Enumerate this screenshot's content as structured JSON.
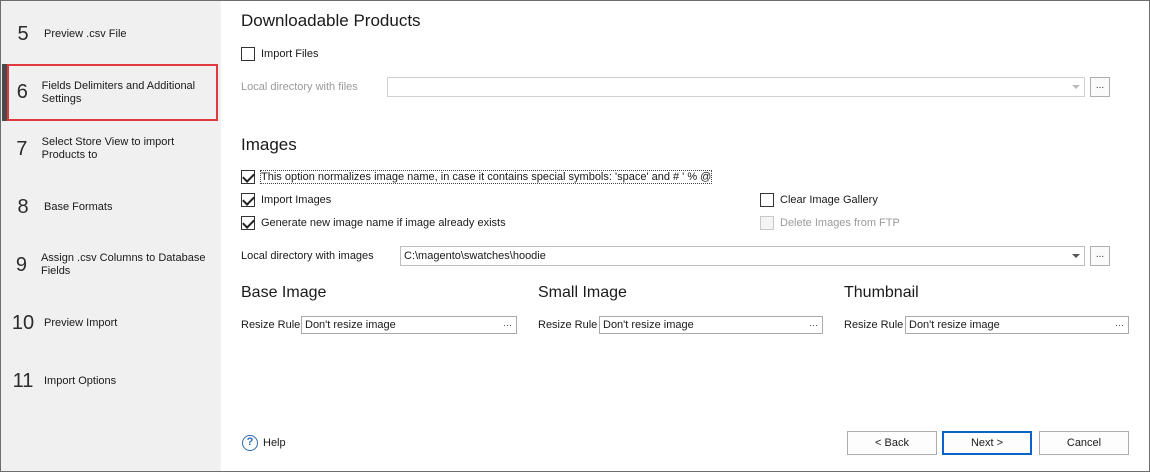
{
  "sidebar": {
    "steps": [
      {
        "num": "5",
        "label": "Preview .csv File"
      },
      {
        "num": "6",
        "label": "Fields Delimiters and Additional Settings"
      },
      {
        "num": "7",
        "label": "Select Store View to import Products to"
      },
      {
        "num": "8",
        "label": "Base Formats"
      },
      {
        "num": "9",
        "label": "Assign .csv Columns to Database Fields"
      },
      {
        "num": "10",
        "label": "Preview Import"
      },
      {
        "num": "11",
        "label": "Import Options"
      }
    ]
  },
  "downloadable": {
    "title": "Downloadable Products",
    "import_files_label": "Import Files",
    "local_dir_label": "Local directory with files",
    "local_dir_value": "",
    "browse_label": "..."
  },
  "images": {
    "title": "Images",
    "normalize_label": "This option normalizes image name, in case it contains special symbols: 'space' and # ' % @",
    "import_images_label": "Import Images",
    "generate_name_label": "Generate new image name if image already exists",
    "clear_gallery_label": "Clear Image Gallery",
    "delete_ftp_label": "Delete Images from FTP",
    "local_dir_label": "Local directory with images",
    "local_dir_value": "C:\\magento\\swatches\\hoodie",
    "browse_label": "..."
  },
  "resize": {
    "groups": [
      {
        "title": "Base Image",
        "rule_label": "Resize Rule",
        "value": "Don't resize image"
      },
      {
        "title": "Small Image",
        "rule_label": "Resize Rule",
        "value": "Don't resize image"
      },
      {
        "title": "Thumbnail",
        "rule_label": "Resize Rule",
        "value": "Don't resize image"
      }
    ],
    "ellipsis": "···"
  },
  "footer": {
    "help_label": "Help",
    "help_icon": "?",
    "back_label": "< Back",
    "next_label": "Next >",
    "cancel_label": "Cancel"
  },
  "colors": {
    "highlight_border": "#e0393e",
    "primary_border": "#0a64c8",
    "sidebar_bg": "#f0f0f0"
  }
}
